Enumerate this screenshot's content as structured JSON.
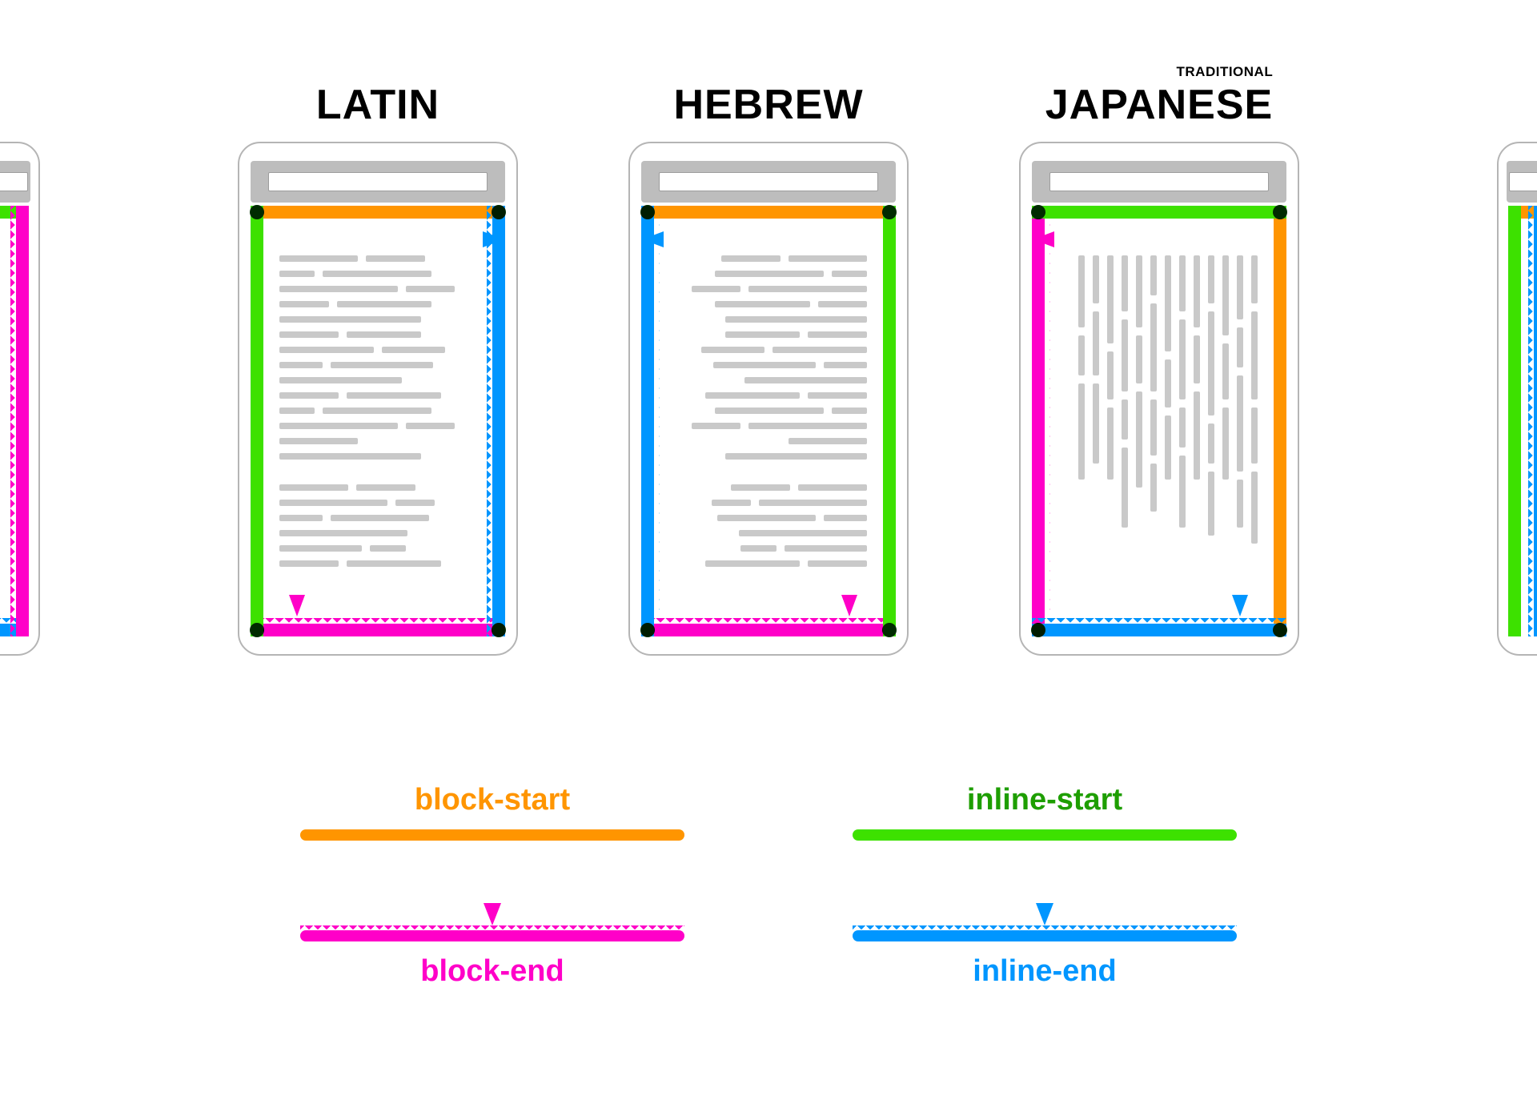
{
  "headings": {
    "latin": "LATIN",
    "hebrew": "HEBREW",
    "japanese": "JAPANESE",
    "japanese_super": "TRADITIONAL"
  },
  "legend": {
    "block_start": "block-start",
    "block_end": "block-end",
    "inline_start": "inline-start",
    "inline_end": "inline-end"
  },
  "colors": {
    "block_start": "#FF9500",
    "block_end": "#FF00C8",
    "inline_start": "#3DE100",
    "inline_end": "#0096FF"
  },
  "layouts": {
    "latin": {
      "block_start": "top",
      "block_end": "bottom",
      "inline_start": "left",
      "inline_end": "right"
    },
    "hebrew": {
      "block_start": "top",
      "block_end": "bottom",
      "inline_start": "right",
      "inline_end": "left"
    },
    "japanese": {
      "block_start": "right",
      "block_end": "left",
      "inline_start": "top",
      "inline_end": "bottom"
    }
  }
}
